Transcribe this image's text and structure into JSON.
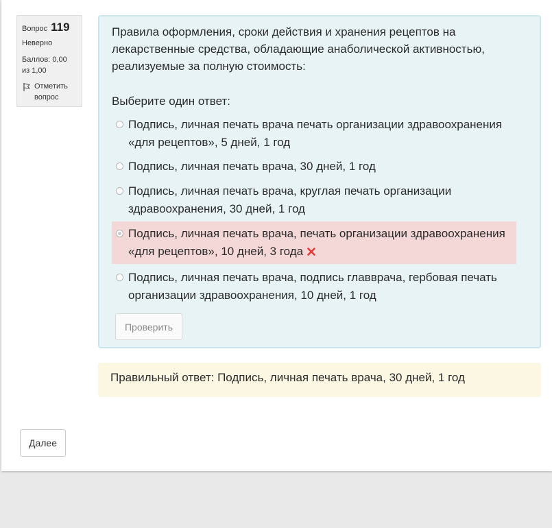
{
  "question_info": {
    "label": "Вопрос",
    "number": "119",
    "state": "Неверно",
    "grade": "Баллов: 0,00 из 1,00",
    "flag_label": "Отметить вопрос"
  },
  "question": {
    "text": "Правила оформления, сроки действия и хранения рецептов на лекарственные средства, обладающие анаболической активностью, реализуемые за полную стоимость:",
    "prompt": "Выберите один ответ:",
    "answers": [
      {
        "text": "Подпись, личная печать врача печать организации здравоохранения «для рецептов», 5 дней, 1 год",
        "selected": false
      },
      {
        "text": "Подпись, личная печать врача, 30 дней, 1 год",
        "selected": false
      },
      {
        "text": "Подпись, личная печать врача, круглая печать организации здравоохранения, 30 дней, 1 год",
        "selected": false
      },
      {
        "text": "Подпись, личная печать врача, печать организации здравоохранения «для рецептов», 10 дней, 3 года",
        "selected": true,
        "incorrect": true
      },
      {
        "text": "Подпись, личная печать врача, подпись главврача, гербовая печать организации здравоохранения, 10 дней, 1 год",
        "selected": false
      }
    ],
    "check_button": "Проверить"
  },
  "feedback": {
    "right_answer": "Правильный ответ: Подпись, личная печать врача, 30 дней, 1 год"
  },
  "navigation": {
    "next_button": "Далее"
  },
  "colors": {
    "formulation_bg": "#e7f3f5",
    "incorrect_bg": "#f4d7d7",
    "outcome_bg": "#fcf7e3",
    "incorrect_mark": "#e53935"
  }
}
